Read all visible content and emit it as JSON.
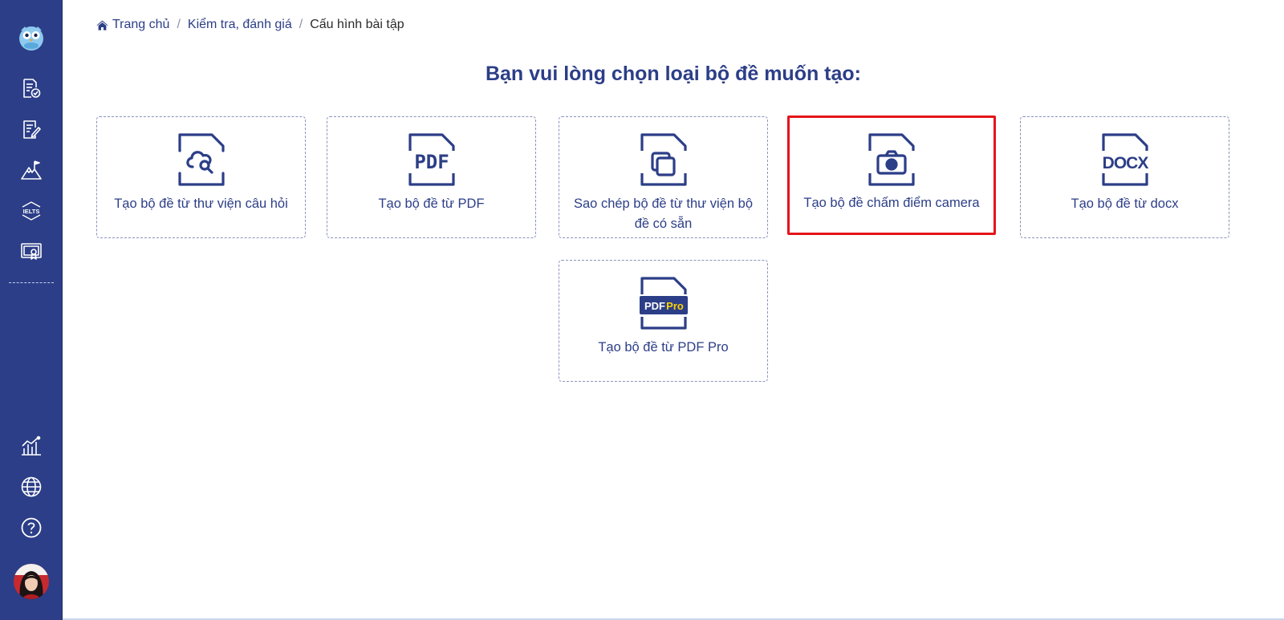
{
  "breadcrumb": {
    "home": "Trang chủ",
    "section": "Kiểm tra, đánh giá",
    "current": "Cấu hình bài tập"
  },
  "page": {
    "title": "Bạn vui lòng chọn loại bộ đề muốn tạo:"
  },
  "cards": [
    {
      "label": "Tạo bộ đề từ thư viện câu hỏi",
      "icon": "cloud-search-file-icon"
    },
    {
      "label": "Tạo bộ đề từ PDF",
      "icon": "pdf-file-icon",
      "icon_text": "PDF"
    },
    {
      "label": "Sao chép bộ đề từ thư viện bộ đề có sẵn",
      "icon": "copy-file-icon"
    },
    {
      "label": "Tạo bộ đề chấm điểm camera",
      "icon": "camera-file-icon",
      "selected": true
    },
    {
      "label": "Tạo bộ đề từ docx",
      "icon": "docx-file-icon",
      "icon_text": "DOCX"
    },
    {
      "label": "Tạo bộ đề từ PDF Pro",
      "icon": "pdf-pro-file-icon",
      "icon_text": "PDF",
      "icon_badge": "Pro"
    }
  ],
  "sidebar": {
    "items": [
      {
        "name": "logo",
        "icon": "owl-logo-icon"
      },
      {
        "name": "assignments",
        "icon": "checklist-document-icon"
      },
      {
        "name": "exams",
        "icon": "edit-document-icon"
      },
      {
        "name": "achievements",
        "icon": "mountain-flag-icon"
      },
      {
        "name": "ielts",
        "icon": "ielts-icon",
        "icon_text": "IELTS"
      },
      {
        "name": "certificates",
        "icon": "certificate-icon"
      },
      {
        "name": "statistics",
        "icon": "chart-icon"
      },
      {
        "name": "language",
        "icon": "globe-icon"
      },
      {
        "name": "help",
        "icon": "help-icon"
      }
    ]
  },
  "colors": {
    "sidebar_bg": "#2c3e87",
    "primary": "#2c3e87",
    "highlight_border": "#e4141b",
    "pro_badge": "#ffd200"
  }
}
